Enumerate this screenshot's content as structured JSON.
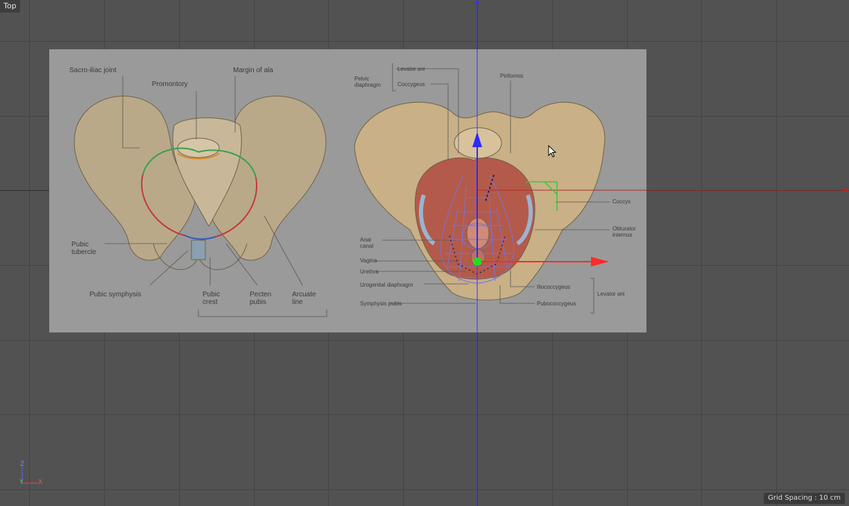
{
  "viewport": {
    "view_name": "Top",
    "grid_spacing": "Grid Spacing : 10 cm",
    "axis_labels": {
      "z": "Z",
      "y": "Y",
      "x": "X"
    }
  },
  "reference_image": {
    "left_panel_labels": {
      "sacroiliac": "Sacro-iliac joint",
      "promontory": "Promontory",
      "margin_ala": "Margin of ala",
      "pubic_tubercle": "Pubic tubercle",
      "pubic_symphysis": "Pubic symphysis",
      "pubic_crest": "Pubic crest",
      "pecten_pubis": "Pecten pubis",
      "arcuate_line": "Arcuate line"
    },
    "right_panel_labels": {
      "pelvic_diaphragm": "Pelvic diaphragm",
      "levator_ani": "Levator ani",
      "coccygeus": "Coccygeus",
      "piriformis": "Piriformis",
      "coccyx": "Coccyx",
      "obturator_internus": "Obturator internus",
      "anal_canal": "Anal canal",
      "vagina": "Vagina",
      "urethra": "Urethra",
      "urogenital_diaphragm": "Urogenital diaphragm",
      "symphysis_pubis": "Symphysis pubis",
      "iliococcygeus": "Iliococcygeus",
      "pubococcygeus": "Pubococcygeus",
      "levator_ani_bracket": "Levator ani"
    }
  },
  "colors": {
    "background": "#525252",
    "axis_y": "#2a2aff",
    "axis_x": "#ff2a2a",
    "pivot": "#22dd22",
    "mesh": "#6b6bdc"
  },
  "icons": [
    "cursor-icon",
    "axis-indicator-icon",
    "move-axis-y-icon",
    "move-axis-x-icon",
    "pivot-icon"
  ]
}
